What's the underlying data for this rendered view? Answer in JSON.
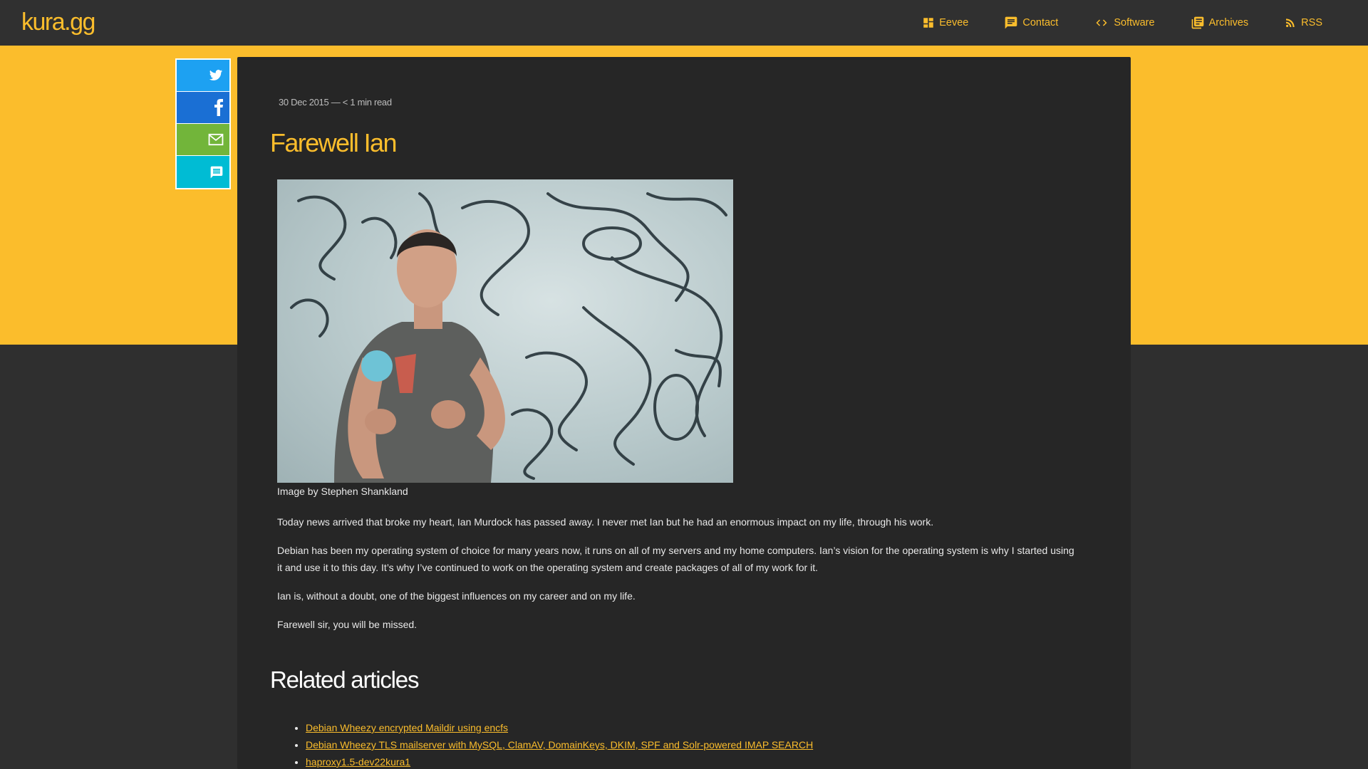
{
  "site": {
    "logo": "kura.gg"
  },
  "nav": [
    {
      "label": "Eevee",
      "icon": "dashboard-icon"
    },
    {
      "label": "Contact",
      "icon": "chat-icon"
    },
    {
      "label": "Software",
      "icon": "code-icon"
    },
    {
      "label": "Archives",
      "icon": "library-icon"
    },
    {
      "label": "RSS",
      "icon": "rss-icon"
    }
  ],
  "share": [
    {
      "name": "twitter",
      "icon": "twitter-icon",
      "color": "#1da1f2"
    },
    {
      "name": "facebook",
      "icon": "facebook-icon",
      "color": "#1a6fd4"
    },
    {
      "name": "email",
      "icon": "mail-icon",
      "color": "#72b53a"
    },
    {
      "name": "comment",
      "icon": "comment-icon",
      "color": "#00bcd4"
    }
  ],
  "post": {
    "meta": "30 Dec 2015 — < 1 min read",
    "title": "Farewell Ian",
    "image_caption": "Image by Stephen Shankland",
    "paragraphs": [
      "Today news arrived that broke my heart, Ian Murdock has passed away. I never met Ian but he had an enormous impact on my life, through his work.",
      "Debian has been my operating system of choice for many years now, it runs on all of my servers and my home computers. Ian’s vision for the operating system is why I started using it and use it to this day. It’s why I’ve continued to work on the operating system and create packages of all of my work for it.",
      "Ian is, without a doubt, one of the biggest influences on my career and on my life.",
      "Farewell sir, you will be missed."
    ]
  },
  "related": {
    "title": "Related articles",
    "items": [
      "Debian Wheezy encrypted Maildir using encfs",
      "Debian Wheezy TLS mailserver with MySQL, ClamAV, DomainKeys, DKIM, SPF and Solr-powered IMAP SEARCH",
      "haproxy1.5-dev22kura1"
    ]
  },
  "colors": {
    "accent": "#fbbd2c",
    "header_bg": "#303030",
    "card_bg": "#262626",
    "page_bg": "#2f2f2f"
  }
}
